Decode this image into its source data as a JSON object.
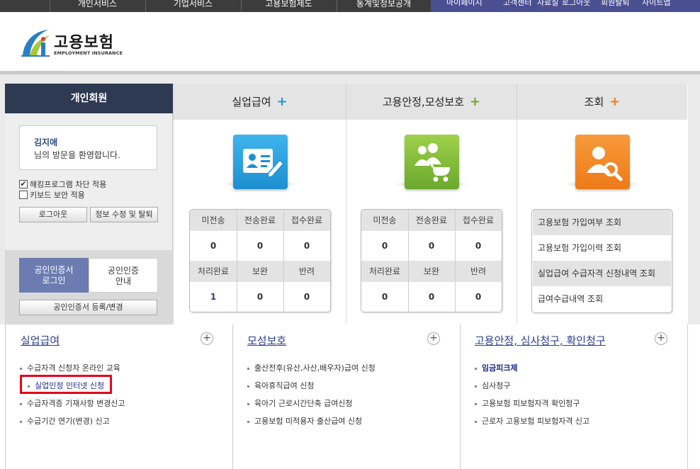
{
  "top_nav": {
    "items": [
      "개인서비스",
      "기업서비스",
      "고용보험제도",
      "통계및정보공개"
    ],
    "util": [
      "마이페이지",
      "고객센터",
      "자료실",
      "로그아웃",
      "회원탈퇴",
      "사이트맵"
    ]
  },
  "logo": {
    "title": "고용보험",
    "subtitle": "EMPLOYMENT INSURANCE"
  },
  "login": {
    "header": "개인회원",
    "user_name": "김지애",
    "welcome_msg": "님의 방문을 환영합니다.",
    "check1": "해킹프로그램 차단 적용",
    "check2": "키보드 보안 적용",
    "logout": "로그아웃",
    "edit": "정보 수정 및 탈퇴",
    "cert_login": [
      "공인인증서",
      "로그인"
    ],
    "cert_info": [
      "공인인증",
      "안내"
    ],
    "cert_register": "공인인증서 등록/변경"
  },
  "columns": [
    {
      "title": "실업급여",
      "plus": "+",
      "color": "#1e9ad6"
    },
    {
      "title": "고용안정,모성보호",
      "plus": "+",
      "color": "#6aa82d"
    },
    {
      "title": "조회",
      "plus": "+",
      "color": "#f07e1d"
    }
  ],
  "status_tables": [
    {
      "labels": [
        "미전송",
        "전송완료",
        "접수완료",
        "처리완료",
        "보완",
        "반려"
      ],
      "values": [
        "0",
        "0",
        "0",
        "1",
        "0",
        "0"
      ]
    },
    {
      "labels": [
        "미전송",
        "전송완료",
        "접수완료",
        "처리완료",
        "보완",
        "반려"
      ],
      "values": [
        "0",
        "0",
        "0",
        "0",
        "0",
        "0"
      ]
    }
  ],
  "queries": [
    "고용보험 가입여부 조회",
    "고용보험 가입이력 조회",
    "실업급여 수급자격 신청내역 조회",
    "급여수급내역 조회"
  ],
  "bottom": [
    {
      "title": "실업급여",
      "items": [
        "수급자격 신청자 온라인 교육",
        "실업인정 인터넷 신청",
        "수급자격증 기재사항 변경신고",
        "수급기간 연기(변경) 신고"
      ]
    },
    {
      "title": "모성보호",
      "items": [
        "출산전후(유산,사산,배우자)급여 신청",
        "육아휴직급여 신청",
        "육아기 근로시간단축 급여신청",
        "고용보험 미적용자 출산급여 신청"
      ]
    },
    {
      "title": "고용안정, 심사청구, 확인청구",
      "items": [
        "임금피크제",
        "심사청구",
        "고용보험 피보험자격 확인청구",
        "근로자 고용보험 피보험자격 신고"
      ]
    }
  ]
}
